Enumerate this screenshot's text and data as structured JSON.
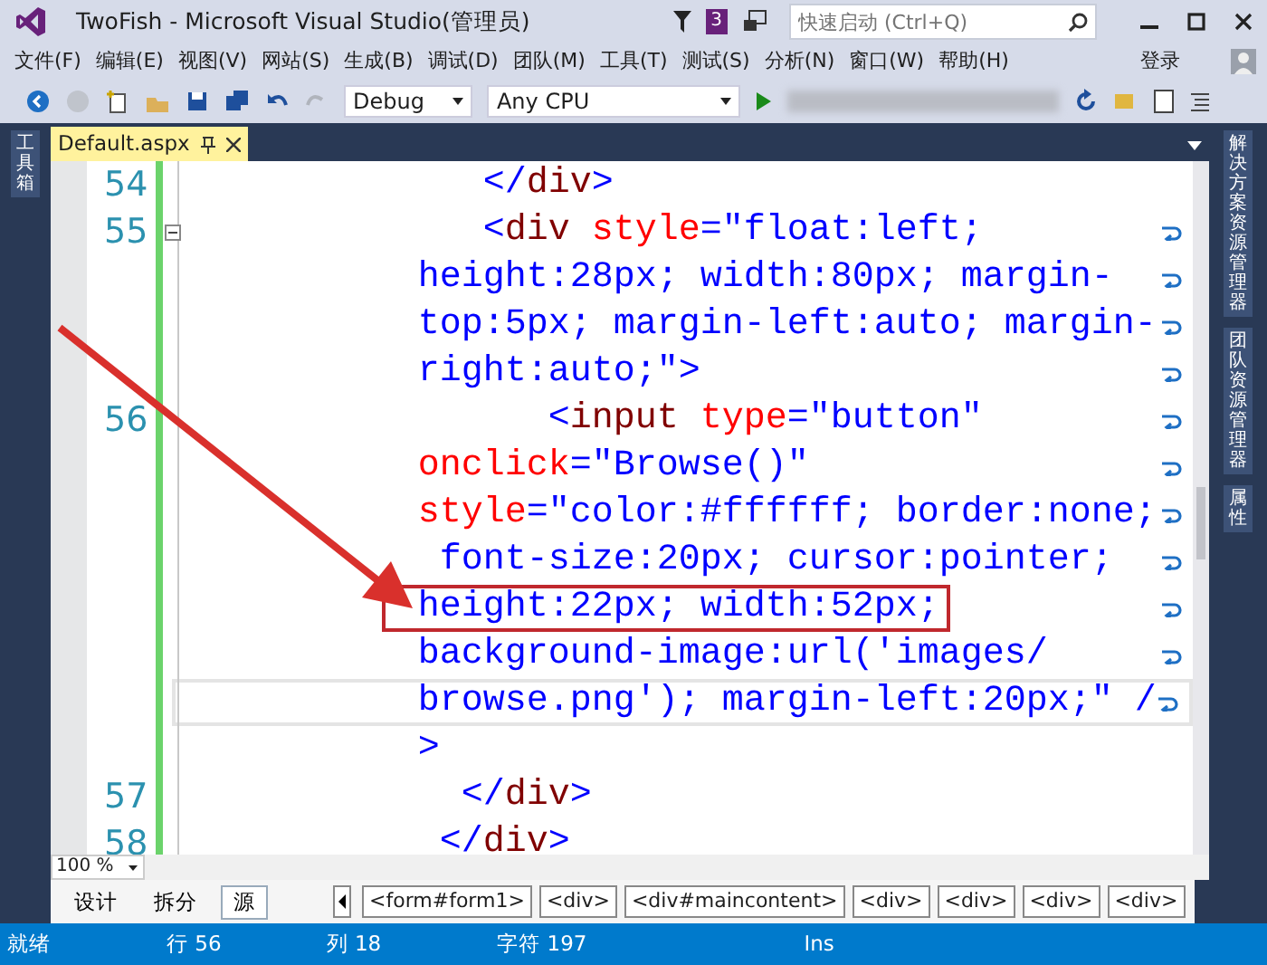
{
  "window": {
    "title": "TwoFish - Microsoft Visual Studio(管理员)",
    "notification_count": "3",
    "quick_launch": {
      "placeholder": "快速启动 (Ctrl+Q)"
    }
  },
  "menu": [
    "文件(F)",
    "编辑(E)",
    "视图(V)",
    "网站(S)",
    "生成(B)",
    "调试(D)",
    "团队(M)",
    "工具(T)",
    "测试(S)",
    "分析(N)",
    "窗口(W)",
    "帮助(H)"
  ],
  "sign_in": "登录",
  "toolbar": {
    "configuration": "Debug",
    "platform": "Any CPU"
  },
  "left_panel_tabs": [
    "工具箱"
  ],
  "right_panel_tabs": [
    "解决方案资源管理器",
    "团队资源管理器",
    "属性"
  ],
  "document_tabs": [
    {
      "label": "Default.aspx",
      "selected": true
    }
  ],
  "editor": {
    "lines": [
      {
        "number": "54",
        "wrap": false,
        "boxed": false,
        "current": false,
        "segments": [
          {
            "t": "   </",
            "kind": "punct"
          },
          {
            "t": "div",
            "kind": "tag"
          },
          {
            "t": ">",
            "kind": "punct"
          }
        ]
      },
      {
        "number": "55",
        "wrap": true,
        "boxed": false,
        "current": false,
        "segments": [
          {
            "t": "   <",
            "kind": "punct"
          },
          {
            "t": "div",
            "kind": "tag"
          },
          {
            "t": " style",
            "kind": "attr"
          },
          {
            "t": "=",
            "kind": "punct"
          },
          {
            "t": "\"float:left;",
            "kind": "value"
          }
        ]
      },
      {
        "wrap": true,
        "boxed": false,
        "current": false,
        "segments": [
          {
            "t": "height:28px; width:80px; margin-",
            "kind": "value"
          }
        ]
      },
      {
        "wrap": true,
        "boxed": false,
        "current": false,
        "segments": [
          {
            "t": "top:5px; margin-left:auto; margin-",
            "kind": "value"
          }
        ]
      },
      {
        "wrap": true,
        "boxed": false,
        "current": false,
        "segments": [
          {
            "t": "right:auto;\"",
            "kind": "value"
          },
          {
            "t": ">",
            "kind": "punct"
          }
        ]
      },
      {
        "number": "56",
        "wrap": true,
        "boxed": false,
        "current": false,
        "segments": [
          {
            "t": "      <",
            "kind": "punct"
          },
          {
            "t": "input",
            "kind": "tag"
          },
          {
            "t": " type",
            "kind": "attr"
          },
          {
            "t": "=",
            "kind": "punct"
          },
          {
            "t": "\"button\"",
            "kind": "value"
          }
        ]
      },
      {
        "wrap": true,
        "boxed": false,
        "current": false,
        "segments": [
          {
            "t": "onclick",
            "kind": "attr"
          },
          {
            "t": "=",
            "kind": "punct"
          },
          {
            "t": "\"Browse()\"",
            "kind": "value"
          }
        ]
      },
      {
        "wrap": true,
        "boxed": false,
        "current": false,
        "segments": [
          {
            "t": "style",
            "kind": "attr"
          },
          {
            "t": "=",
            "kind": "punct"
          },
          {
            "t": "\"color:#ffffff; border:none;",
            "kind": "value"
          }
        ]
      },
      {
        "wrap": true,
        "boxed": false,
        "current": false,
        "segments": [
          {
            "t": " font-size:20px; cursor:pointer;",
            "kind": "value"
          }
        ]
      },
      {
        "wrap": true,
        "boxed": true,
        "current": false,
        "segments": [
          {
            "t": "height:22px; width:52px;",
            "kind": "value"
          }
        ]
      },
      {
        "wrap": true,
        "boxed": false,
        "current": false,
        "segments": [
          {
            "t": "background-image:url('images/",
            "kind": "value"
          }
        ]
      },
      {
        "wrap": true,
        "boxed": false,
        "current": true,
        "segments": [
          {
            "t": "browse.png'); margin-left:20px;\"",
            "kind": "value"
          },
          {
            "t": " /",
            "kind": "punct"
          }
        ]
      },
      {
        "wrap": false,
        "boxed": false,
        "current": false,
        "segments": [
          {
            "t": ">",
            "kind": "punct"
          }
        ]
      },
      {
        "number": "57",
        "wrap": false,
        "boxed": false,
        "current": false,
        "segments": [
          {
            "t": "  </",
            "kind": "punct"
          },
          {
            "t": "div",
            "kind": "tag"
          },
          {
            "t": ">",
            "kind": "punct"
          }
        ]
      },
      {
        "number": "58",
        "wrap": false,
        "boxed": false,
        "current": false,
        "segments": [
          {
            "t": " </",
            "kind": "punct"
          },
          {
            "t": "div",
            "kind": "tag"
          },
          {
            "t": ">",
            "kind": "punct"
          }
        ]
      }
    ],
    "zoom": "100 %"
  },
  "view_tabs": [
    {
      "label": "设计",
      "selected": false
    },
    {
      "label": "拆分",
      "selected": false
    },
    {
      "label": "源",
      "selected": true
    }
  ],
  "breadcrumb": [
    "<form#form1>",
    "<div>",
    "<div#maincontent>",
    "<div>",
    "<div>",
    "<div>",
    "<div>"
  ],
  "status_bar": {
    "state": "就绪",
    "line": "行 56",
    "column": "列 18",
    "char": "字符 197",
    "mode": "Ins"
  }
}
